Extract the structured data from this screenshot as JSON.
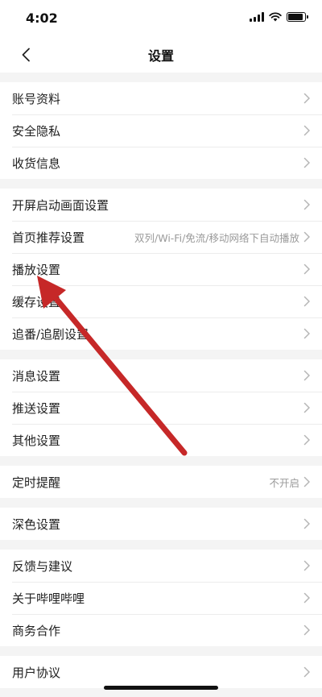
{
  "status_bar": {
    "time": "4:02",
    "battery_level": 0.9
  },
  "header": {
    "title": "设置"
  },
  "groups": [
    {
      "items": [
        {
          "label": "账号资料",
          "value": ""
        },
        {
          "label": "安全隐私",
          "value": ""
        },
        {
          "label": "收货信息",
          "value": ""
        }
      ]
    },
    {
      "items": [
        {
          "label": "开屏启动画面设置",
          "value": ""
        },
        {
          "label": "首页推荐设置",
          "value": "双列/Wi-Fi/免流/移动网络下自动播放"
        },
        {
          "label": "播放设置",
          "value": ""
        },
        {
          "label": "缓存设置",
          "value": ""
        },
        {
          "label": "追番/追剧设置",
          "value": ""
        }
      ]
    },
    {
      "items": [
        {
          "label": "消息设置",
          "value": ""
        },
        {
          "label": "推送设置",
          "value": ""
        },
        {
          "label": "其他设置",
          "value": ""
        }
      ]
    },
    {
      "items": [
        {
          "label": "定时提醒",
          "value": "不开启"
        }
      ]
    },
    {
      "items": [
        {
          "label": "深色设置",
          "value": ""
        }
      ]
    },
    {
      "items": [
        {
          "label": "反馈与建议",
          "value": ""
        },
        {
          "label": "关于哔哩哔哩",
          "value": ""
        },
        {
          "label": "商务合作",
          "value": ""
        }
      ]
    },
    {
      "items": [
        {
          "label": "用户协议",
          "value": ""
        }
      ]
    }
  ],
  "colors": {
    "annotation_arrow": "#c62828",
    "chevron": "#b5b5b5",
    "divider": "#ececec",
    "background": "#f4f4f4"
  },
  "icons": {
    "back": "chevron-left-icon",
    "row_arrow": "chevron-right-icon"
  }
}
